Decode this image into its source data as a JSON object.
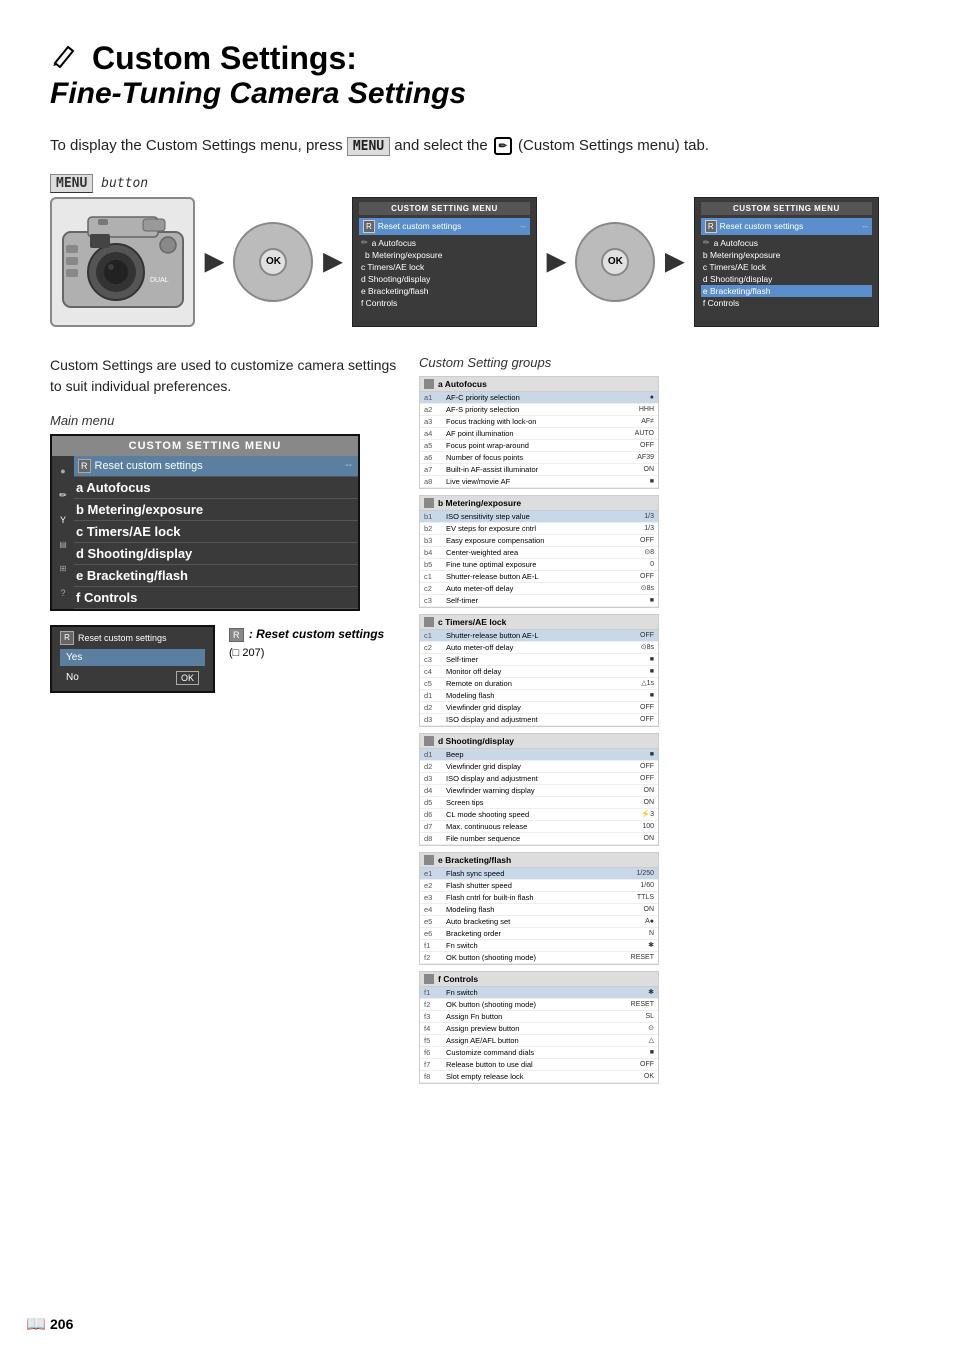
{
  "page": {
    "number": "206"
  },
  "title": {
    "pencil": "✏",
    "main": "Custom Settings:",
    "sub": "Fine-Tuning Camera Settings"
  },
  "intro": {
    "text_before": "To display the Custom Settings menu, press",
    "menu_label": "MENU",
    "text_middle": "and select the",
    "text_after": "(Custom Settings menu) tab."
  },
  "menu_button_section": {
    "label": "MENU",
    "italic": "button"
  },
  "custom_settings_description": "Custom Settings are used to customize camera settings to suit individual preferences.",
  "custom_setting_groups_label": "Custom Setting groups",
  "main_menu_label": "Main menu",
  "menu_title": "CUSTOM SETTING MENU",
  "menu_items": [
    {
      "icon": "R",
      "label": "Reset custom settings",
      "value": "--"
    },
    {
      "icon": "a",
      "label": "Autofocus"
    },
    {
      "icon": "b",
      "label": "Metering/exposure"
    },
    {
      "icon": "c",
      "label": "Timers/AE lock"
    },
    {
      "icon": "d",
      "label": "Shooting/display"
    },
    {
      "icon": "e",
      "label": "Bracketing/flash"
    },
    {
      "icon": "f",
      "label": "Controls"
    }
  ],
  "sidebar_icons": [
    "pencil",
    "Y",
    "image",
    "grid",
    "?"
  ],
  "reset_sub": {
    "header_icon": "R",
    "header_label": "Reset custom settings",
    "yes": "Yes",
    "no": "No",
    "ok": "OK"
  },
  "reset_desc": {
    "icon": "R",
    "text": ": Reset custom settings",
    "ref": "(□ 207)"
  },
  "groups": {
    "a": {
      "header": "a Autofocus",
      "items": [
        {
          "num": "a1",
          "label": "AF-C priority selection",
          "val": "●"
        },
        {
          "num": "a2",
          "label": "AF-S priority selection",
          "val": "HHH"
        },
        {
          "num": "a3",
          "label": "Focus tracking with lock-on",
          "val": "AF≠"
        },
        {
          "num": "a4",
          "label": "AF point illumination",
          "val": "AUTO"
        },
        {
          "num": "a5",
          "label": "Focus point wrap-around",
          "val": "OFF"
        },
        {
          "num": "a6",
          "label": "Number of focus points",
          "val": "AF39"
        },
        {
          "num": "a7",
          "label": "Built-in AF-assist illuminator",
          "val": "ON"
        },
        {
          "num": "a8",
          "label": "Live view/movie AF",
          "val": "■"
        }
      ]
    },
    "b": {
      "header": "b Metering/exposure",
      "items": [
        {
          "num": "b1",
          "label": "ISO sensitivity step value",
          "val": "1/3"
        },
        {
          "num": "b2",
          "label": "EV steps for exposure cntrl",
          "val": "1/3"
        },
        {
          "num": "b3",
          "label": "Easy exposure compensation",
          "val": "OFF"
        },
        {
          "num": "b4",
          "label": "Center-weighted area",
          "val": "⊙8"
        },
        {
          "num": "b5",
          "label": "Fine tune optimal exposure",
          "val": "0"
        },
        {
          "num": "c1",
          "label": "Shutter-release button AE-L",
          "val": "OFF"
        },
        {
          "num": "c2",
          "label": "Auto meter-off delay",
          "val": "⊙8s"
        },
        {
          "num": "c3",
          "label": "Self-timer",
          "val": "■"
        }
      ]
    },
    "c": {
      "header": "c Timers/AE lock",
      "items": [
        {
          "num": "c1",
          "label": "Shutter-release button AE-L",
          "val": "OFF"
        },
        {
          "num": "c2",
          "label": "Auto meter-off delay",
          "val": "⊙8s"
        },
        {
          "num": "c3",
          "label": "Self-timer",
          "val": "■"
        },
        {
          "num": "c4",
          "label": "Monitor off delay",
          "val": "■"
        },
        {
          "num": "c5",
          "label": "Remote on duration",
          "val": "△ 1s"
        },
        {
          "num": "d1",
          "label": "Modeling flash",
          "val": "■"
        },
        {
          "num": "d2",
          "label": "Viewfinder grid display",
          "val": "OFF"
        },
        {
          "num": "d3",
          "label": "ISO display and adjustment",
          "val": "OFF"
        }
      ]
    },
    "d": {
      "header": "d Shooting/display",
      "items": [
        {
          "num": "d1",
          "label": "Beep",
          "val": "■"
        },
        {
          "num": "d2",
          "label": "Viewfinder grid display",
          "val": "OFF"
        },
        {
          "num": "d3",
          "label": "ISO display and adjustment",
          "val": "OFF"
        },
        {
          "num": "d4",
          "label": "Viewfinder warning display",
          "val": "ON"
        },
        {
          "num": "d5",
          "label": "Screen tips",
          "val": "ON"
        },
        {
          "num": "d6",
          "label": "CL mode shooting speed",
          "val": "⚡3"
        },
        {
          "num": "d7",
          "label": "Max. continuous release",
          "val": "100"
        },
        {
          "num": "d8",
          "label": "File number sequence",
          "val": "ON"
        }
      ]
    },
    "e": {
      "header": "e Bracketing/flash",
      "items": [
        {
          "num": "e1",
          "label": "Flash sync speed",
          "val": "1/250"
        },
        {
          "num": "e2",
          "label": "Flash shutter speed",
          "val": "1/60"
        },
        {
          "num": "e3",
          "label": "Flash cntrl for built-in flash",
          "val": "TTLS"
        },
        {
          "num": "e4",
          "label": "Modeling flash",
          "val": "ON"
        },
        {
          "num": "e5",
          "label": "Auto bracketing set",
          "val": "A●"
        },
        {
          "num": "e6",
          "label": "Bracketing order",
          "val": "N"
        },
        {
          "num": "f1",
          "label": "Fn switch",
          "val": "✱"
        },
        {
          "num": "f2",
          "label": "OK button (shooting mode)",
          "val": "RESET"
        }
      ]
    },
    "f": {
      "header": "f Controls",
      "items": [
        {
          "num": "f1",
          "label": "Fn switch",
          "val": "✱"
        },
        {
          "num": "f2",
          "label": "OK button (shooting mode)",
          "val": "RESET"
        },
        {
          "num": "f3",
          "label": "Assign Fn button",
          "val": "SL"
        },
        {
          "num": "f4",
          "label": "Assign preview button",
          "val": "⊙"
        },
        {
          "num": "f5",
          "label": "Assign AE/AFL button",
          "val": "△"
        },
        {
          "num": "f6",
          "label": "Customize command dials",
          "val": "■"
        },
        {
          "num": "f7",
          "label": "Release button to use dial",
          "val": "OFF"
        },
        {
          "num": "f8",
          "label": "Slot empty release lock",
          "val": "OK"
        }
      ]
    }
  }
}
